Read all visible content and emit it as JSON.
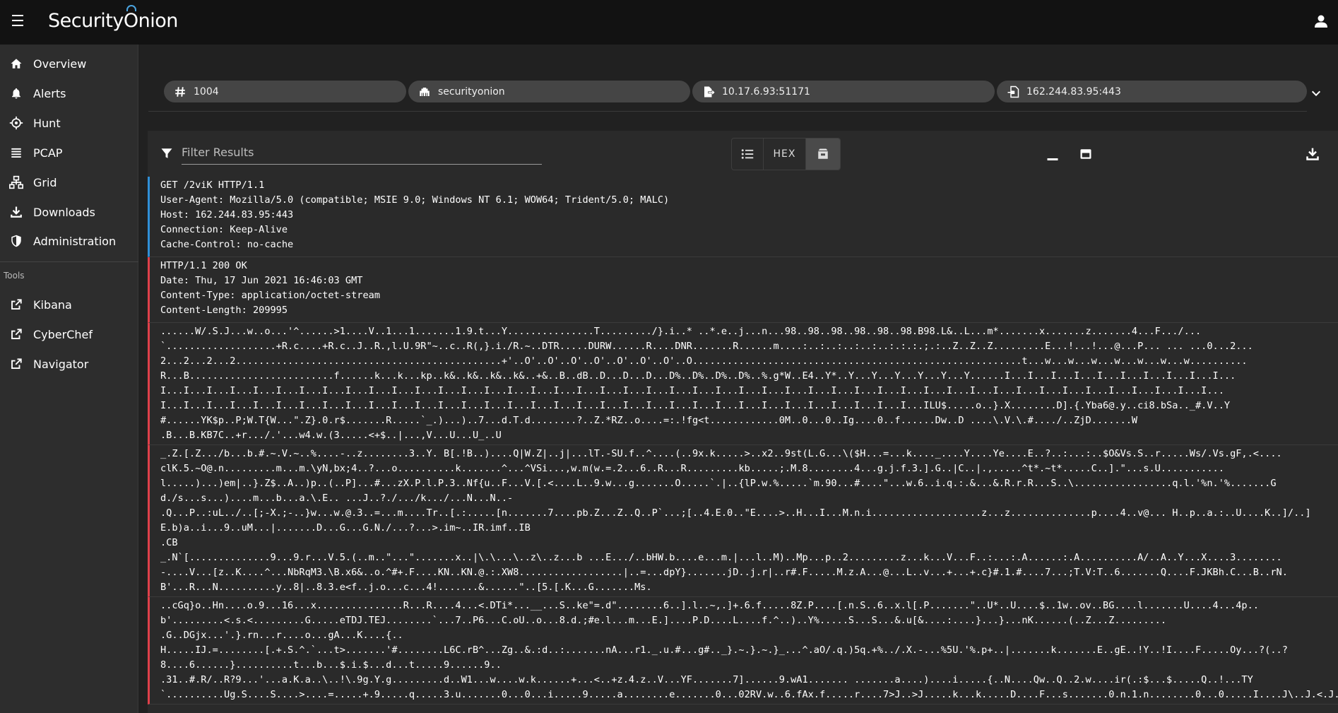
{
  "app": {
    "logo_text": "Security",
    "logo_text2": "nion",
    "logo_o": "O"
  },
  "sidebar": {
    "items": [
      {
        "label": "Overview",
        "icon": "home-icon"
      },
      {
        "label": "Alerts",
        "icon": "bell-icon"
      },
      {
        "label": "Hunt",
        "icon": "crosshair-icon"
      },
      {
        "label": "PCAP",
        "icon": "list-icon"
      },
      {
        "label": "Grid",
        "icon": "network-icon"
      },
      {
        "label": "Downloads",
        "icon": "download-icon"
      },
      {
        "label": "Administration",
        "icon": "shield-icon"
      }
    ],
    "tools_label": "Tools",
    "tools": [
      {
        "label": "Kibana",
        "icon": "external-link-icon"
      },
      {
        "label": "CyberChef",
        "icon": "external-link-icon"
      },
      {
        "label": "Navigator",
        "icon": "external-link-icon"
      }
    ]
  },
  "chips": {
    "id": "1004",
    "sensor": "securityonion",
    "source": "10.17.6.93:51171",
    "destination": "162.244.83.95:443"
  },
  "toolbar": {
    "filter_placeholder": "Filter Results",
    "hex_label": "HEX"
  },
  "stream": {
    "request": [
      "GET /2viK HTTP/1.1",
      "User-Agent: Mozilla/5.0 (compatible; MSIE 9.0; Windows NT 6.1; WOW64; Trident/5.0; MALC)",
      "Host: 162.244.83.95:443",
      "Connection: Keep-Alive",
      "Cache-Control: no-cache"
    ],
    "response": [
      "HTTP/1.1 200 OK",
      "Date: Thu, 17 Jun 2021 16:46:03 GMT",
      "Content-Type: application/octet-stream",
      "Content-Length: 209995"
    ],
    "data_block_1": [
      "......W/.S.J...w..o...'^......>1....V..1...1.......1.9.t...Y...............T........./}.i..* ..*.e..j...n...98..98..98..98..98..98.B98.L&..L...m*.......x.......z.......4...F.../...",
      "`...................+R.c....+R.c..J..R.,l.U.9R\"~..c..R(,}.i./R.~..DTR.....DURW......R....DNR.......R......m....:..:..:..:..:..:.:.:.;.:..Z..Z..Z.........E...!...!...@...P... ... ...0...2...",
      "2...2...2...2..............................................+'..O'..O'..O'..O'..O'..O'..O'..O.........................................................t...w...w...w...w...w...w...w..........",
      "R...B.........................f......k...k...kp..k&..k&..k&..k&..+&..B..dB..D...D...D...D%..D%..D%..D%..%.g*W..E4..Y*..Y...Y...Y...Y...Y...Y......I...I...I...I...I...I...I...I...I...I...",
      "I...I...I...I...I...I...I...I...I...I...I...I...I...I...I...I...I...I...I...I...I...I...I...I...I...I...I...I...I...I...I...I...I...I...I...I...I...I...I...I...I...I...I...I...I...I...",
      "I...I...I...I...I...I...I...I...I...I...I...I...I...I...I...I...I...I...I...I...I...I...I...I...I...I...I...I...I...I...I...I...I...ILU$.....o..}.X........D].{.Yba6@.y..ci8.bSa.._#.V..Y",
      "#......YK$p..P;W.T{W...\".Z}.0.r$.......R.....`_.)...)..7...d.T.d........?..Z.*RZ..o....=:.!fg<t............0M..0...0..Ig....0..f......Dw..D ....\\.V.\\.#..../..ZjD.......W",
      ".B...B.KB7C..+r.../.'...w4.w.(3.....<+$..|...,V...U...U_..U"
    ],
    "data_block_2": [
      "_.Z.[.Z.../b...b.#.~.V.~..%....-..z........3..Y. B[.!B..)....Q|W.Z|..j|...lT.-SU.f..^....(..9x.k.....>..x2..9st(L.G...\\($H...=...k...._....Y....Ye....E..?..:...:..$O&Vs.S..r.....Ws/.Vs.gF,.<....",
      "clK.5.~O@.n.........m...m.\\yN,bx;4..?...o..........k.......^...^VSi...,w.m(w.=.2...6..R...R.........kb.....;.M.8........4...g.j.f.3.].G..|C..|.,.....^t*.~t*.....C..].\"...s.U...........",
      "l.....)...)em|..}.Z$..A..)p..(..P]...#...zX.P.l.P.3..Nf{u..F...V.[.<....L..9.w...g.......O.....`.|..{lP.w.%.....`m.90...#....\"...w.6..i.q.:.&...&.R.r.R...S..\\.................q.l.'%n.'%.......G",
      "d./s...s...)....m...b...a.\\.E.. ...J..?./.../k.../...N...N..-",
      ".Q...P..:uL../..[;-X.;-..}w...w.@.3..=...m....Tr..[.:.....[n.......7....pb.Z...Z..Q..P`...;[..4.E.0..\"E....>..H...I...M.n.i...................z...z..............p....4..v@... H..p..a.:..U....K..]/..]",
      "E.b)a..i...9..uM...|.......D...G...G.N./...?...>.im~..IR.imf..IB",
      ".CB",
      "_.N`[..............9...9.r...V.5.(..m..\"...\".......x..|\\.\\...\\..z\\..z...b ...E.../..bHW.b....e...m.|...l..M)..Mp...p..2.........z...k...V...F..:...:.A......:.A..........A/..A..Y...X....3........",
      "-....V...[z..K....^...NbRqM3.\\B.x6&..o.^#+.F....KN..KN.@.:.XW8..................|..=...dpY}.......jD..j.r|..r#.F.....M.z.A...@...L..v...+...+.c}#.1.#....7...;T.V:T..6.......Q....F.JKBh.C...B..rN.",
      "B'...R...N..........y..8|..8.3.e<f..j.o...c...4!.......&......\"..[5.[.K...G.......Ms."
    ],
    "data_block_3": [
      "..cGq}o..Hn....o.9...16...x...............R...R....4...<.DTi*...__...S..ke\"=.d\"........6..].l..~,.]+.6.f.....8Z.P....[.n.S..6..x.l[.P.......\"..U*..U....$..1w..ov..BG....l.......U....4...4p..",
      "b'.........<.s.<.........G.....eTDJ.TEJ........`...7..P6...C.oU..o...8.d.;#e.l...m...E.]....P.D....L....f.^..)..Y%.....S...S...&.u[&....:....}...}...nK......(..Z...Z.........",
      ".G..DGjx...'.}.rn...r....o...gA...K....{..",
      "H.....IJ.=........[.+.S.^.`...t>.......'#........L6C.rB^...Zg..&.:d..:.......nA...r1._.u.#...g#.._}.~.}.~.}_...^.aO/.q.)5q.+%../.X.-...%5U.'%.p+..|.......k.......E..gE..!Y..!I....F.....Oy...?(..?",
      "8....6......}..........t...b...$.i.$...d...t.....9......9..",
      ".31..#.R/..R?9...'...a.K.a..\\..!\\.9g.Y.g.........d..W1...w....w.k......+...<..+z.4.z..V...YF.......7]......9.wA1....... .......a....)....i.....{..N....Qw..Q..2.w....ir(.:$...$.....Q..!...TY",
      "`..........Ug.S....S....>....=.....+.9.....q.....3.u.......0...0...i.....9.....a........e.......0...02RV.w..6.fAx.f.....r....7>J..>J.....k...k.....D....F...s.......0.n.1.n........0...0.....I....J\\..J.<.J...N...ut."
    ]
  }
}
